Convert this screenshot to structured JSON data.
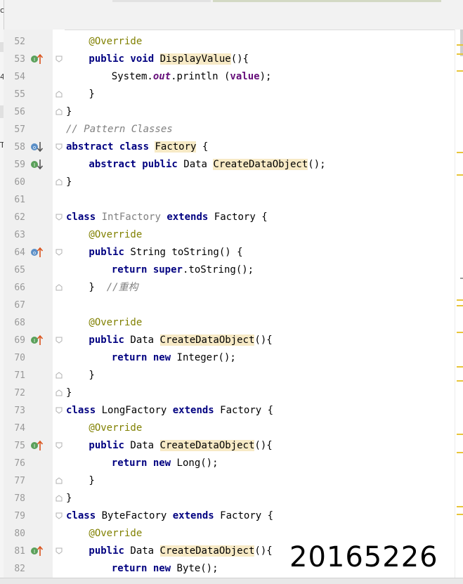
{
  "colors": {
    "keyword": "#000080",
    "annotation": "#808000",
    "comment": "#808080",
    "field": "#660e7a",
    "highlight": "#f7eac6",
    "line_number": "#999999"
  },
  "left_panel": {
    "glyphs": [
      "c",
      "4",
      "T"
    ]
  },
  "lines": [
    {
      "num": "52",
      "indent": 2,
      "gutter": [],
      "fold": null,
      "tokens": [
        [
          "ann",
          "@Override"
        ]
      ]
    },
    {
      "num": "53",
      "indent": 2,
      "gutter": [
        "implements-icon",
        "arrow-up-icon"
      ],
      "fold": "open",
      "tokens": [
        [
          "kw",
          "public"
        ],
        [
          "",
          " "
        ],
        [
          "kw",
          "void"
        ],
        [
          "",
          " "
        ],
        [
          "hl",
          "DisplayValue"
        ],
        [
          "",
          "(){"
        ]
      ]
    },
    {
      "num": "54",
      "indent": 4,
      "gutter": [],
      "fold": null,
      "tokens": [
        [
          "",
          "System."
        ],
        [
          "fld",
          "out"
        ],
        [
          "",
          ".println ("
        ],
        [
          "var",
          "value"
        ],
        [
          "",
          ");"
        ]
      ]
    },
    {
      "num": "55",
      "indent": 2,
      "gutter": [],
      "fold": "close",
      "tokens": [
        [
          "",
          "}"
        ]
      ]
    },
    {
      "num": "56",
      "indent": 0,
      "gutter": [],
      "fold": "close",
      "tokens": [
        [
          "",
          "}"
        ]
      ]
    },
    {
      "num": "57",
      "indent": 0,
      "gutter": [],
      "fold": null,
      "tokens": [
        [
          "cm",
          "// Pattern Classes"
        ]
      ]
    },
    {
      "num": "58",
      "indent": 0,
      "gutter": [
        "overridden-icon",
        "arrow-down-icon"
      ],
      "fold": "open",
      "tokens": [
        [
          "kw",
          "abstract"
        ],
        [
          "",
          " "
        ],
        [
          "kw",
          "class"
        ],
        [
          "",
          " "
        ],
        [
          "hl",
          "Factory"
        ],
        [
          "",
          " {"
        ]
      ]
    },
    {
      "num": "59",
      "indent": 2,
      "gutter": [
        "implements-icon",
        "arrow-down-icon"
      ],
      "fold": null,
      "tokens": [
        [
          "kw",
          "abstract"
        ],
        [
          "",
          " "
        ],
        [
          "kw",
          "public"
        ],
        [
          "",
          " Data "
        ],
        [
          "hl",
          "CreateDataObject"
        ],
        [
          "",
          "();"
        ]
      ]
    },
    {
      "num": "60",
      "indent": 0,
      "gutter": [],
      "fold": "close",
      "tokens": [
        [
          "",
          "}"
        ]
      ]
    },
    {
      "num": "61",
      "indent": 0,
      "gutter": [],
      "fold": null,
      "tokens": []
    },
    {
      "num": "62",
      "indent": 0,
      "gutter": [],
      "fold": "open",
      "tokens": [
        [
          "kw",
          "class"
        ],
        [
          "",
          " "
        ],
        [
          "gray",
          "IntFactory"
        ],
        [
          "",
          " "
        ],
        [
          "kw",
          "extends"
        ],
        [
          "",
          " Factory {"
        ]
      ]
    },
    {
      "num": "63",
      "indent": 2,
      "gutter": [],
      "fold": null,
      "tokens": [
        [
          "ann",
          "@Override"
        ]
      ]
    },
    {
      "num": "64",
      "indent": 2,
      "gutter": [
        "overridden-icon",
        "arrow-up-icon"
      ],
      "fold": "open",
      "tokens": [
        [
          "kw",
          "public"
        ],
        [
          "",
          " String toString() {"
        ]
      ]
    },
    {
      "num": "65",
      "indent": 4,
      "gutter": [],
      "fold": null,
      "tokens": [
        [
          "kw",
          "return"
        ],
        [
          "",
          " "
        ],
        [
          "kw",
          "super"
        ],
        [
          "",
          ".toString();"
        ]
      ]
    },
    {
      "num": "66",
      "indent": 2,
      "gutter": [],
      "fold": "close",
      "tokens": [
        [
          "",
          "}  "
        ],
        [
          "cm",
          "//重构"
        ]
      ]
    },
    {
      "num": "67",
      "indent": 0,
      "gutter": [],
      "fold": null,
      "tokens": []
    },
    {
      "num": "68",
      "indent": 2,
      "gutter": [],
      "fold": null,
      "tokens": [
        [
          "ann",
          "@Override"
        ]
      ]
    },
    {
      "num": "69",
      "indent": 2,
      "gutter": [
        "implements-icon",
        "arrow-up-icon"
      ],
      "fold": "open",
      "tokens": [
        [
          "kw",
          "public"
        ],
        [
          "",
          " Data "
        ],
        [
          "hl",
          "CreateDataObject"
        ],
        [
          "",
          "(){"
        ]
      ]
    },
    {
      "num": "70",
      "indent": 4,
      "gutter": [],
      "fold": null,
      "tokens": [
        [
          "kw",
          "return"
        ],
        [
          "",
          " "
        ],
        [
          "kw",
          "new"
        ],
        [
          "",
          " Integer();"
        ]
      ]
    },
    {
      "num": "71",
      "indent": 2,
      "gutter": [],
      "fold": "close",
      "tokens": [
        [
          "",
          "}"
        ]
      ]
    },
    {
      "num": "72",
      "indent": 0,
      "gutter": [],
      "fold": "close",
      "tokens": [
        [
          "",
          "}"
        ]
      ]
    },
    {
      "num": "73",
      "indent": 0,
      "gutter": [],
      "fold": "open",
      "tokens": [
        [
          "kw",
          "class"
        ],
        [
          "",
          " LongFactory "
        ],
        [
          "kw",
          "extends"
        ],
        [
          "",
          " Factory {"
        ]
      ]
    },
    {
      "num": "74",
      "indent": 2,
      "gutter": [],
      "fold": null,
      "tokens": [
        [
          "ann",
          "@Override"
        ]
      ]
    },
    {
      "num": "75",
      "indent": 2,
      "gutter": [
        "implements-icon",
        "arrow-up-icon"
      ],
      "fold": "open",
      "tokens": [
        [
          "kw",
          "public"
        ],
        [
          "",
          " Data "
        ],
        [
          "hl",
          "CreateDataObject"
        ],
        [
          "",
          "(){"
        ]
      ]
    },
    {
      "num": "76",
      "indent": 4,
      "gutter": [],
      "fold": null,
      "tokens": [
        [
          "kw",
          "return"
        ],
        [
          "",
          " "
        ],
        [
          "kw",
          "new"
        ],
        [
          "",
          " Long();"
        ]
      ]
    },
    {
      "num": "77",
      "indent": 2,
      "gutter": [],
      "fold": "close",
      "tokens": [
        [
          "",
          "}"
        ]
      ]
    },
    {
      "num": "78",
      "indent": 0,
      "gutter": [],
      "fold": "close",
      "tokens": [
        [
          "",
          "}"
        ]
      ]
    },
    {
      "num": "79",
      "indent": 0,
      "gutter": [],
      "fold": "open",
      "tokens": [
        [
          "kw",
          "class"
        ],
        [
          "",
          " ByteFactory "
        ],
        [
          "kw",
          "extends"
        ],
        [
          "",
          " Factory {"
        ]
      ]
    },
    {
      "num": "80",
      "indent": 2,
      "gutter": [],
      "fold": null,
      "tokens": [
        [
          "ann",
          "@Override"
        ]
      ]
    },
    {
      "num": "81",
      "indent": 2,
      "gutter": [
        "implements-icon",
        "arrow-up-icon"
      ],
      "fold": "open",
      "tokens": [
        [
          "kw",
          "public"
        ],
        [
          "",
          " Data "
        ],
        [
          "hl",
          "CreateDataObject"
        ],
        [
          "",
          "(){"
        ]
      ]
    },
    {
      "num": "82",
      "indent": 4,
      "gutter": [],
      "fold": null,
      "tokens": [
        [
          "kw",
          "return"
        ],
        [
          "",
          " "
        ],
        [
          "kw",
          "new"
        ],
        [
          "",
          " Byte();"
        ]
      ]
    }
  ],
  "overlay_text": "20165226"
}
